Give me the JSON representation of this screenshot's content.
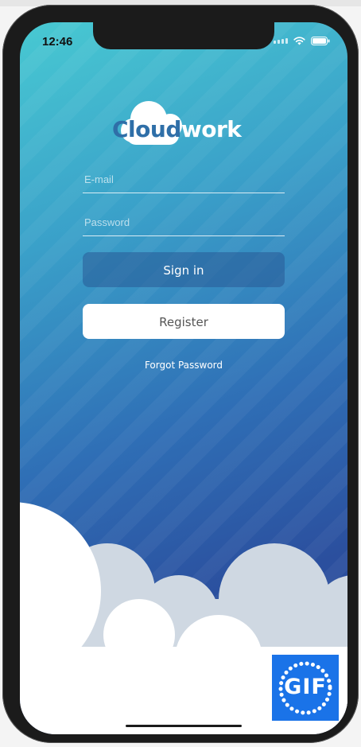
{
  "status_bar": {
    "time": "12:46",
    "icons": [
      "signal-icon",
      "wifi-icon",
      "battery-icon"
    ]
  },
  "logo": {
    "cloud_part": "Cloud",
    "rest_part": "work"
  },
  "login_form": {
    "email_placeholder": "E-mail",
    "email_value": "",
    "password_placeholder": "Password",
    "password_value": "",
    "sign_in_label": "Sign in",
    "register_label": "Register",
    "forgot_password_label": "Forgot Password"
  },
  "overlay": {
    "gif_badge_label": "GIF"
  },
  "colors": {
    "gradient_top": "#48c9d2",
    "gradient_bottom": "#2b4a98",
    "sign_in_bg": "#2f5f9a",
    "register_bg": "#ffffff",
    "gif_badge_bg": "#1a73e8"
  }
}
